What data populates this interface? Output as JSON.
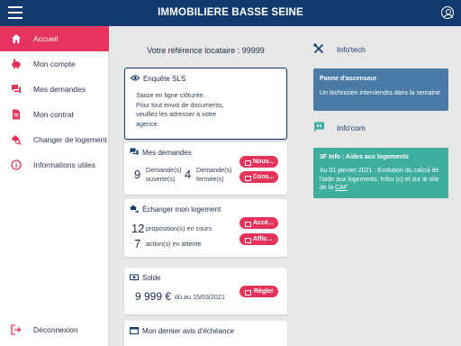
{
  "app": {
    "title": "IMMOBILIERE BASSE SEINE"
  },
  "sidebar": {
    "items": [
      {
        "label": "Accueil",
        "icon": "home-icon",
        "active": true
      },
      {
        "label": "Mon compte",
        "icon": "piggy-bank-icon",
        "active": false
      },
      {
        "label": "Mes demandes",
        "icon": "chat-bubbles-icon",
        "active": false
      },
      {
        "label": "Mon contrat",
        "icon": "document-icon",
        "active": false
      },
      {
        "label": "Changer de logement",
        "icon": "house-search-icon",
        "active": false
      },
      {
        "label": "Informations utiles",
        "icon": "info-circle-icon",
        "active": false
      }
    ],
    "logout": {
      "label": "Déconnexion",
      "icon": "logout-icon"
    }
  },
  "main": {
    "reference": "Votre référence locataire : 99999",
    "enquete": {
      "title": "Enquête SLS",
      "lines": [
        "Saisie en ligne clôturée.",
        "Pour tout envoi de documents,",
        "veuillez les adresser à votre",
        "agence."
      ]
    },
    "demandes": {
      "title": "Mes demandes",
      "open_count": "9",
      "open_label_1": "Demande(s)",
      "open_label_2": "ouverte(s)",
      "closed_count": "4",
      "closed_label_1": "Demande(s)",
      "closed_label_2": "fermée(s)",
      "new_button": "Nouv...",
      "consult_button": "Cons..."
    },
    "echanger": {
      "title": "Échanger mon logement",
      "proposals_count": "12",
      "proposals_label": "proposition(s) en cours",
      "actions_count": "7",
      "actions_label": "action(s) en attente",
      "access_button": "Accè...",
      "display_button": "Affic..."
    },
    "solde": {
      "title": "Solde",
      "amount": "9 999 €",
      "due_label": "dû au 15/03/2021",
      "pay_button": "Régler"
    },
    "avis": {
      "title": "Mon dernier avis d'échéance"
    }
  },
  "right": {
    "infotech": {
      "label": "Info'tech",
      "icon": "tools-icon",
      "card_title": "Panne d'ascenseur",
      "card_body": "Un technicien interviendra dans la semaine",
      "card_color": "#4a7ba6"
    },
    "infocom": {
      "label": "Info'com",
      "icon": "chat-quote-icon",
      "card_title": "3F Info : Aides aux logements",
      "card_body": "Au 01 janvier 2021 : Evolution du calcul de l'aide aux logements. Infos (c) et sur le site de la ",
      "card_link": "CAF",
      "card_color": "#3fae9f"
    }
  },
  "colors": {
    "brand": "#123a6e",
    "accent": "#e4345c"
  }
}
